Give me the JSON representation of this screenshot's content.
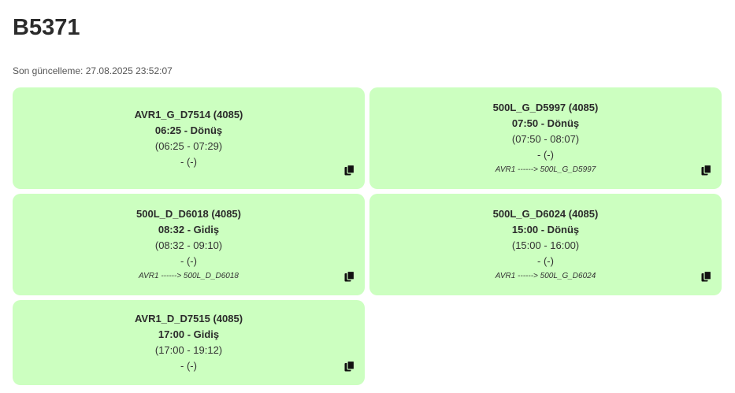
{
  "page": {
    "title": "B5371",
    "updated": "Son güncelleme: 27.08.2025 23:52:07"
  },
  "cards": [
    {
      "id": "AVR1_G_D7514 (4085)",
      "time_dir": "06:25 - Dönüş",
      "range": "(06:25 - 07:29)",
      "extra": "- (-)",
      "route": ""
    },
    {
      "id": "500L_G_D5997 (4085)",
      "time_dir": "07:50 - Dönüş",
      "range": "(07:50 - 08:07)",
      "extra": "- (-)",
      "route": "AVR1 ------> 500L_G_D5997"
    },
    {
      "id": "500L_D_D6018 (4085)",
      "time_dir": "08:32 - Gidiş",
      "range": "(08:32 - 09:10)",
      "extra": "- (-)",
      "route": "AVR1 ------> 500L_D_D6018"
    },
    {
      "id": "500L_G_D6024 (4085)",
      "time_dir": "15:00 - Dönüş",
      "range": "(15:00 - 16:00)",
      "extra": "- (-)",
      "route": "AVR1 ------> 500L_G_D6024"
    },
    {
      "id": "AVR1_D_D7515 (4085)",
      "time_dir": "17:00 - Gidiş",
      "range": "(17:00 - 19:12)",
      "extra": "- (-)",
      "route": ""
    }
  ],
  "icons": {
    "copy": "copy-icon"
  },
  "colors": {
    "card_background": "#ccffc0",
    "title_text": "#2b2b2b"
  }
}
